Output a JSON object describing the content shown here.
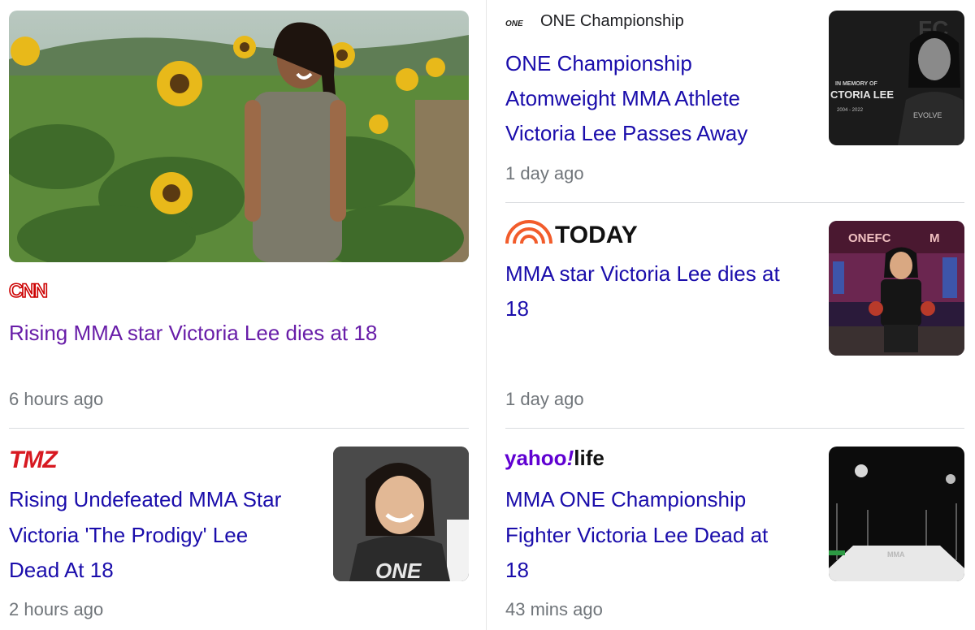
{
  "articles": [
    {
      "source": "CNN",
      "headline": "Rising MMA star Victoria Lee dies at 18",
      "time": "6 hours ago",
      "image": "sunflower-field-photo"
    },
    {
      "source": "ONE Championship",
      "source_logo_text": "ONE",
      "headline_lines": [
        "ONE Championship",
        "Atomweight MMA Athlete",
        "Victoria Lee Passes Away"
      ],
      "time": "1 day ago",
      "image_text": {
        "top": "FC",
        "memory": "IN MEMORY OF",
        "name": "CTORIA LEE",
        "years": "2004 - 2022",
        "brand": "EVOLVE"
      }
    },
    {
      "source": "TODAY",
      "headline_lines": [
        "MMA star Victoria Lee dies at",
        "18"
      ],
      "time": "1 day ago",
      "image_text": {
        "banner": "ONEFC",
        "banner_end": "M"
      }
    },
    {
      "source": "TMZ",
      "headline_lines": [
        "Rising Undefeated MMA Star",
        "Victoria 'The Prodigy' Lee",
        "Dead At 18"
      ],
      "time": "2 hours ago",
      "image_text": {
        "shirt": "ONE"
      }
    },
    {
      "source": "yahoo!life",
      "source_parts": {
        "a": "yahoo",
        "b": "!",
        "c": "life"
      },
      "headline_lines": [
        "MMA ONE Championship",
        "Fighter Victoria Lee Dead at",
        "18"
      ],
      "time": "43 mins ago",
      "image_text": {
        "mat": "MMA"
      }
    }
  ],
  "colors": {
    "link": "#1a0dab",
    "visited": "#681da8",
    "meta": "#70757a",
    "cnn_red": "#cc0000",
    "tmz_red": "#d71921",
    "today_orange": "#f25c2b",
    "yahoo_purple": "#6001d2"
  }
}
